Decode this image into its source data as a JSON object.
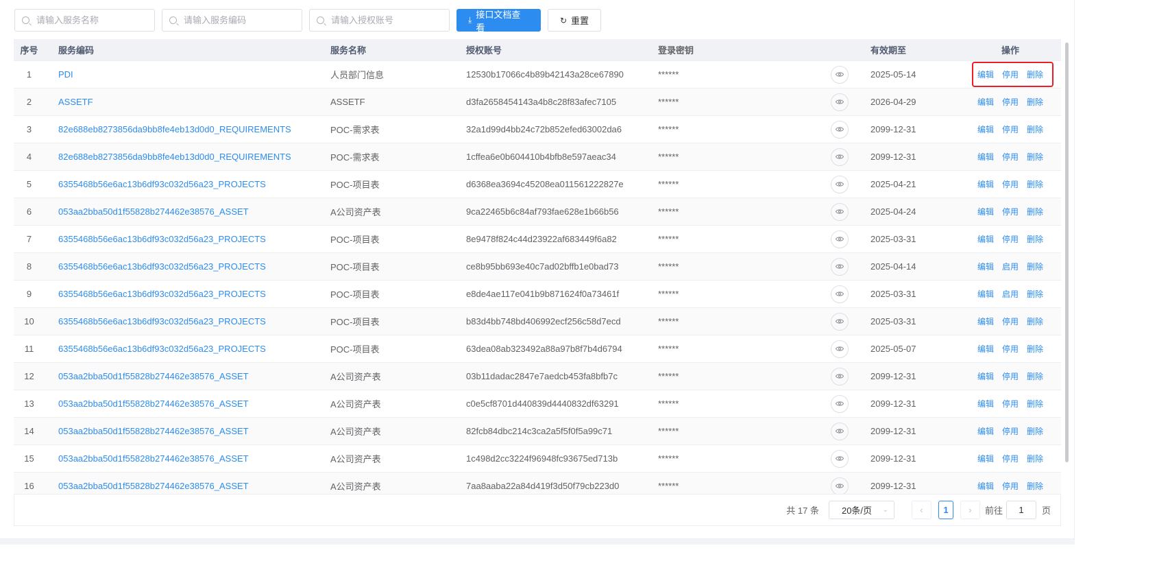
{
  "search": {
    "name_placeholder": "请输入服务名称",
    "code_placeholder": "请输入服务编码",
    "account_placeholder": "请输入授权账号"
  },
  "toolbar": {
    "docs_label": "接口文档查看",
    "reset_label": "重置"
  },
  "columns": [
    "序号",
    "服务编码",
    "服务名称",
    "授权账号",
    "登录密钥",
    "有效期至",
    "操作"
  ],
  "actions": {
    "edit": "编辑",
    "delete": "删除"
  },
  "rows": [
    {
      "no": "1",
      "code": "PDI",
      "name": "人员部门信息",
      "account": "12530b17066c4b89b42143a28ce67890",
      "key": "******",
      "expiry": "2025-05-14",
      "toggle": "停用"
    },
    {
      "no": "2",
      "code": "ASSETF",
      "name": "ASSETF",
      "account": "d3fa2658454143a4b8c28f83afec7105",
      "key": "******",
      "expiry": "2026-04-29",
      "toggle": "停用"
    },
    {
      "no": "3",
      "code": "82e688eb8273856da9bb8fe4eb13d0d0_REQUIREMENTS",
      "name": "POC-需求表",
      "account": "32a1d99d4bb24c72b852efed63002da6",
      "key": "******",
      "expiry": "2099-12-31",
      "toggle": "停用"
    },
    {
      "no": "4",
      "code": "82e688eb8273856da9bb8fe4eb13d0d0_REQUIREMENTS",
      "name": "POC-需求表",
      "account": "1cffea6e0b604410b4bfb8e597aeac34",
      "key": "******",
      "expiry": "2099-12-31",
      "toggle": "停用"
    },
    {
      "no": "5",
      "code": "6355468b56e6ac13b6df93c032d56a23_PROJECTS",
      "name": "POC-项目表",
      "account": "d6368ea3694c45208ea011561222827e",
      "key": "******",
      "expiry": "2025-04-21",
      "toggle": "停用"
    },
    {
      "no": "6",
      "code": "053aa2bba50d1f55828b274462e38576_ASSET",
      "name": "A公司资产表",
      "account": "9ca22465b6c84af793fae628e1b66b56",
      "key": "******",
      "expiry": "2025-04-24",
      "toggle": "停用"
    },
    {
      "no": "7",
      "code": "6355468b56e6ac13b6df93c032d56a23_PROJECTS",
      "name": "POC-项目表",
      "account": "8e9478f824c44d23922af683449f6a82",
      "key": "******",
      "expiry": "2025-03-31",
      "toggle": "停用"
    },
    {
      "no": "8",
      "code": "6355468b56e6ac13b6df93c032d56a23_PROJECTS",
      "name": "POC-项目表",
      "account": "ce8b95bb693e40c7ad02bffb1e0bad73",
      "key": "******",
      "expiry": "2025-04-14",
      "toggle": "启用"
    },
    {
      "no": "9",
      "code": "6355468b56e6ac13b6df93c032d56a23_PROJECTS",
      "name": "POC-项目表",
      "account": "e8de4ae117e041b9b871624f0a73461f",
      "key": "******",
      "expiry": "2025-03-31",
      "toggle": "启用"
    },
    {
      "no": "10",
      "code": "6355468b56e6ac13b6df93c032d56a23_PROJECTS",
      "name": "POC-项目表",
      "account": "b83d4bb748bd406992ecf256c58d7ecd",
      "key": "******",
      "expiry": "2025-03-31",
      "toggle": "停用"
    },
    {
      "no": "11",
      "code": "6355468b56e6ac13b6df93c032d56a23_PROJECTS",
      "name": "POC-项目表",
      "account": "63dea08ab323492a88a97b8f7b4d6794",
      "key": "******",
      "expiry": "2025-05-07",
      "toggle": "停用"
    },
    {
      "no": "12",
      "code": "053aa2bba50d1f55828b274462e38576_ASSET",
      "name": "A公司资产表",
      "account": "03b11dadac2847e7aedcb453fa8bfb7c",
      "key": "******",
      "expiry": "2099-12-31",
      "toggle": "停用"
    },
    {
      "no": "13",
      "code": "053aa2bba50d1f55828b274462e38576_ASSET",
      "name": "A公司资产表",
      "account": "c0e5cf8701d440839d4440832df63291",
      "key": "******",
      "expiry": "2099-12-31",
      "toggle": "停用"
    },
    {
      "no": "14",
      "code": "053aa2bba50d1f55828b274462e38576_ASSET",
      "name": "A公司资产表",
      "account": "82fcb84dbc214c3ca2a5f5f0f5a99c71",
      "key": "******",
      "expiry": "2099-12-31",
      "toggle": "停用"
    },
    {
      "no": "15",
      "code": "053aa2bba50d1f55828b274462e38576_ASSET",
      "name": "A公司资产表",
      "account": "1c498d2cc3224f96948fc93675ed713b",
      "key": "******",
      "expiry": "2099-12-31",
      "toggle": "停用"
    },
    {
      "no": "16",
      "code": "053aa2bba50d1f55828b274462e38576_ASSET",
      "name": "A公司资产表",
      "account": "7aa8aaba22a84d419f3d50f79cb223d0",
      "key": "******",
      "expiry": "2099-12-31",
      "toggle": "停用"
    }
  ],
  "pagination": {
    "total_label": "共 17 条",
    "page_size": "20条/页",
    "current_page": "1",
    "goto_label": "前往",
    "goto_value": "1",
    "page_suffix": "页"
  },
  "colors": {
    "accent": "#2d8cf0",
    "highlight": "#ee1c25"
  }
}
